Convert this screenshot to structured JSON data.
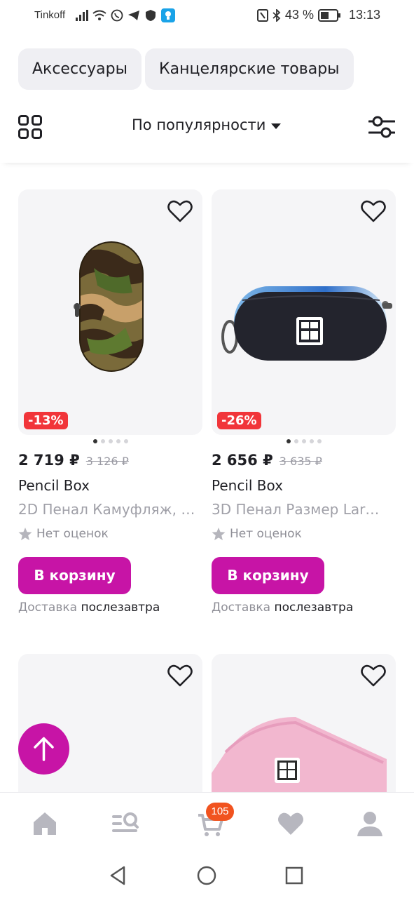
{
  "status_bar": {
    "carrier": "Tinkoff",
    "battery_percent": "43 %",
    "time": "13:13"
  },
  "categories": [
    "Аксессуары",
    "Канцелярские товары"
  ],
  "toolbar": {
    "sort_label": "По популярности"
  },
  "products": [
    {
      "discount": "-13%",
      "price": "2 719 ₽",
      "old_price": "3 126 ₽",
      "brand": "Pencil Box",
      "name": "2D Пенал Камуфляж, …",
      "rating_text": "Нет оценок",
      "cart_label": "В корзину",
      "delivery_label": "Доставка",
      "delivery_value": "послезавтра",
      "image_dots": 5,
      "active_dot": 0
    },
    {
      "discount": "-26%",
      "price": "2 656 ₽",
      "old_price": "3 635 ₽",
      "brand": "Pencil Box",
      "name": "3D Пенал Размер Lar…",
      "rating_text": "Нет оценок",
      "cart_label": "В корзину",
      "delivery_label": "Доставка",
      "delivery_value": "послезавтра",
      "image_dots": 5,
      "active_dot": 0
    }
  ],
  "bottom_nav": {
    "items": [
      "home-icon",
      "catalog-search-icon",
      "cart-icon",
      "favorites-icon",
      "profile-icon"
    ],
    "cart_badge": "105"
  },
  "colors": {
    "accent": "#c714a6",
    "discount": "#f1353a",
    "badge": "#f1531f"
  }
}
